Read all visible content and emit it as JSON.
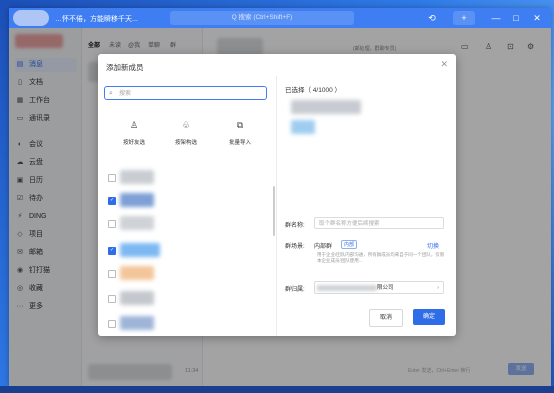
{
  "titlebar": {
    "text": "…怀不倦，方能瞬移千天...",
    "search_placeholder": "Q  搜索 (Ctrl+Shift+F)",
    "plus": "+",
    "minimize": "—",
    "maximize": "□",
    "close": "✕",
    "history": "⟲"
  },
  "nav": {
    "items": [
      {
        "label": "消息",
        "icon": "chat-icon",
        "glyph": "▤"
      },
      {
        "label": "文档",
        "icon": "doc-icon",
        "glyph": "▯"
      },
      {
        "label": "工作台",
        "icon": "grid-icon",
        "glyph": "▦"
      },
      {
        "label": "通讯录",
        "icon": "contacts-icon",
        "glyph": "▭"
      },
      {
        "label": "会议",
        "icon": "meeting-icon",
        "glyph": "◐"
      },
      {
        "label": "云盘",
        "icon": "cloud-icon",
        "glyph": "☁"
      },
      {
        "label": "日历",
        "icon": "calendar-icon",
        "glyph": "▣"
      },
      {
        "label": "待办",
        "icon": "todo-icon",
        "glyph": "☑"
      },
      {
        "label": "DING",
        "icon": "ding-icon",
        "glyph": "⚡"
      },
      {
        "label": "项目",
        "icon": "project-icon",
        "glyph": "◇"
      },
      {
        "label": "邮箱",
        "icon": "mail-icon",
        "glyph": "✉"
      },
      {
        "label": "钉打猫",
        "icon": "cat-icon",
        "glyph": "◉"
      },
      {
        "label": "收藏",
        "icon": "star-icon",
        "glyph": "◎"
      },
      {
        "label": "更多",
        "icon": "more-icon",
        "glyph": "···"
      }
    ]
  },
  "chatlist": {
    "tabs": [
      "全部",
      "未读",
      "@我",
      "单聊",
      "群"
    ],
    "time": "11:34"
  },
  "chatarea": {
    "hint": "(邮处理，群聊专员)",
    "send_hint": "Enter 发送，Ctrl+Enter 换行",
    "send_btn": "发送"
  },
  "modal": {
    "title": "添加新成员",
    "close": "✕",
    "search_placeholder": "搜索",
    "options": [
      {
        "label": "按好友选",
        "icon": "person-icon",
        "glyph": "♙"
      },
      {
        "label": "按架构选",
        "icon": "org-icon",
        "glyph": "♧"
      },
      {
        "label": "批量导入",
        "icon": "import-icon",
        "glyph": "⧉"
      }
    ],
    "selected_label": "已选择（ 4/1000 ）",
    "group_name_label": "群名称:",
    "group_name_placeholder": "取个群名称方便后续搜索",
    "scene_label": "群场景:",
    "scene_value": "内部群",
    "scene_badge": "内部",
    "scene_switch": "切换",
    "scene_desc": "用于企业/团队内部沟通，所有群成员均来自于同一个团队，仅限本企业成员/团队使用...",
    "org_label": "群归属:",
    "org_value": "限公司",
    "org_chevron": "›",
    "cancel": "取消",
    "ok": "确定",
    "checkbox_states": [
      false,
      true,
      false,
      true,
      false,
      false,
      false
    ]
  },
  "colors": {
    "accent": "#2f6ce8",
    "titlebar": "#3f7ef2"
  }
}
